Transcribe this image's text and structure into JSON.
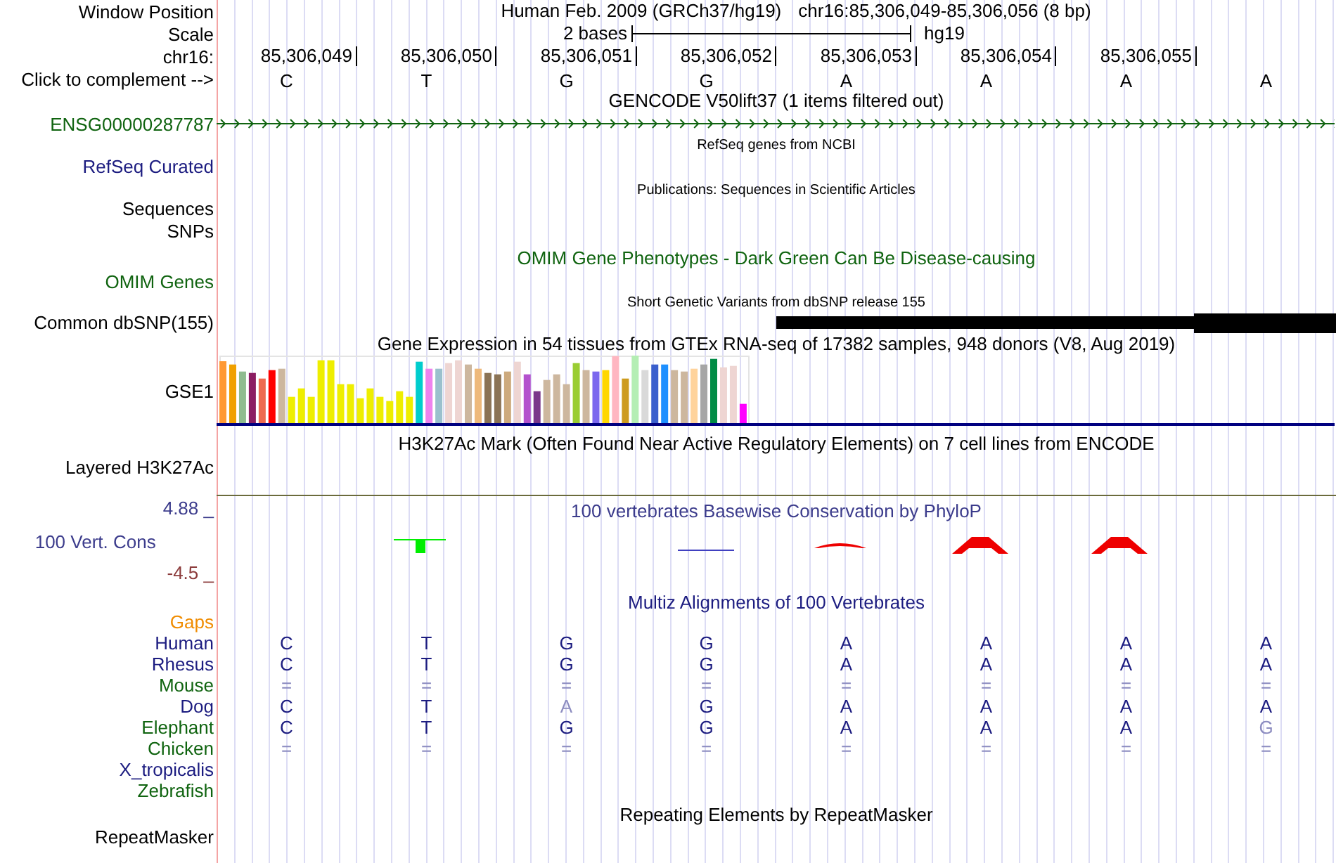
{
  "header": {
    "position_label": "Window Position",
    "assembly_title": "Human Feb. 2009 (GRCh37/hg19)",
    "position": "chr16:85,306,049-85,306,056 (8 bp)",
    "scale_label": "Scale",
    "scale_text": "2 bases",
    "scale_assembly": "hg19",
    "chrom_label": "chr16:",
    "ticks": [
      "85,306,049",
      "85,306,050",
      "85,306,051",
      "85,306,052",
      "85,306,053",
      "85,306,054",
      "85,306,055"
    ],
    "complement_label": "Click to complement -->",
    "bases": [
      "C",
      "T",
      "G",
      "G",
      "A",
      "A",
      "A",
      "A"
    ]
  },
  "tracks": [
    {
      "kind": "gene",
      "title": "GENCODE V50lift37 (1 items filtered out)",
      "labels": [
        "ENSG00000287787"
      ],
      "color": "#106410"
    },
    {
      "kind": "small",
      "title": "RefSeq genes from NCBI",
      "labels": [
        "RefSeq Curated"
      ],
      "color": "#1c1c80"
    },
    {
      "kind": "small",
      "title": "Publications: Sequences in Scientific Articles",
      "labels": [
        "Sequences",
        "SNPs"
      ],
      "color": "#000000"
    },
    {
      "kind": "omim",
      "title": "OMIM Gene Phenotypes - Dark Green Can Be Disease-causing",
      "labels": [
        "OMIM Genes"
      ],
      "color": "#106410"
    },
    {
      "kind": "snp",
      "title": "Short Genetic Variants from dbSNP release 155",
      "labels": [
        "Common dbSNP(155)"
      ],
      "color": "#000000"
    },
    {
      "kind": "gtex",
      "title": "Gene Expression in 54 tissues from GTEx RNA-seq of 17382 samples, 948 donors (V8, Aug 2019)",
      "labels": [
        "GSE1"
      ],
      "color": "#000000"
    },
    {
      "kind": "h3k27ac",
      "title": "H3K27Ac Mark (Often Found Near Active Regulatory Elements) on 7 cell lines from ENCODE",
      "labels": [
        "Layered H3K27Ac"
      ],
      "color": "#000000"
    },
    {
      "kind": "phylop",
      "title": "100 vertebrates Basewise Conservation by PhyloP",
      "labels": [
        "100 Vert. Cons"
      ],
      "color": "#3c3c8c",
      "axis_max": "4.88 _",
      "axis_min": "-4.5 _"
    },
    {
      "kind": "multiz",
      "title": "Multiz Alignments of 100 Vertebrates",
      "color": "#1c1c80",
      "rows": [
        {
          "label": "Gaps",
          "color": "#f08c00",
          "bases": []
        },
        {
          "label": "Human",
          "color": "#1c1c80",
          "bases": [
            {
              "text": "C",
              "dim": false
            },
            {
              "text": "T",
              "dim": false
            },
            {
              "text": "G",
              "dim": false
            },
            {
              "text": "G",
              "dim": false
            },
            {
              "text": "A",
              "dim": false
            },
            {
              "text": "A",
              "dim": false
            },
            {
              "text": "A",
              "dim": false
            },
            {
              "text": "A",
              "dim": false
            }
          ]
        },
        {
          "label": "Rhesus",
          "color": "#1c1c80",
          "bases": [
            {
              "text": "C",
              "dim": false
            },
            {
              "text": "T",
              "dim": false
            },
            {
              "text": "G",
              "dim": false
            },
            {
              "text": "G",
              "dim": false
            },
            {
              "text": "A",
              "dim": false
            },
            {
              "text": "A",
              "dim": false
            },
            {
              "text": "A",
              "dim": false
            },
            {
              "text": "A",
              "dim": false
            }
          ]
        },
        {
          "label": "Mouse",
          "color": "#106410",
          "bases": [
            {
              "text": "=",
              "dim": true
            },
            {
              "text": "=",
              "dim": true
            },
            {
              "text": "=",
              "dim": true
            },
            {
              "text": "=",
              "dim": true
            },
            {
              "text": "=",
              "dim": true
            },
            {
              "text": "=",
              "dim": true
            },
            {
              "text": "=",
              "dim": true
            },
            {
              "text": "=",
              "dim": true
            }
          ]
        },
        {
          "label": "Dog",
          "color": "#1c1c80",
          "bases": [
            {
              "text": "C",
              "dim": false
            },
            {
              "text": "T",
              "dim": false
            },
            {
              "text": "A",
              "dim": true
            },
            {
              "text": "G",
              "dim": false
            },
            {
              "text": "A",
              "dim": false
            },
            {
              "text": "A",
              "dim": false
            },
            {
              "text": "A",
              "dim": false
            },
            {
              "text": "A",
              "dim": false
            }
          ]
        },
        {
          "label": "Elephant",
          "color": "#106410",
          "bases": [
            {
              "text": "C",
              "dim": false
            },
            {
              "text": "T",
              "dim": false
            },
            {
              "text": "G",
              "dim": false
            },
            {
              "text": "G",
              "dim": false
            },
            {
              "text": "A",
              "dim": false
            },
            {
              "text": "A",
              "dim": false
            },
            {
              "text": "A",
              "dim": false
            },
            {
              "text": "G",
              "dim": true
            }
          ]
        },
        {
          "label": "Chicken",
          "color": "#106410",
          "bases": [
            {
              "text": "=",
              "dim": true
            },
            {
              "text": "=",
              "dim": true
            },
            {
              "text": "=",
              "dim": true
            },
            {
              "text": "=",
              "dim": true
            },
            {
              "text": "=",
              "dim": true
            },
            {
              "text": "=",
              "dim": true
            },
            {
              "text": "=",
              "dim": true
            },
            {
              "text": "=",
              "dim": true
            }
          ]
        },
        {
          "label": "X_tropicalis",
          "color": "#1c1c80",
          "bases": []
        },
        {
          "label": "Zebrafish",
          "color": "#106410",
          "bases": []
        }
      ]
    },
    {
      "kind": "repeat",
      "title": "Repeating Elements by RepeatMasker",
      "labels": [
        "RepeatMasker"
      ],
      "color": "#000000"
    }
  ]
}
